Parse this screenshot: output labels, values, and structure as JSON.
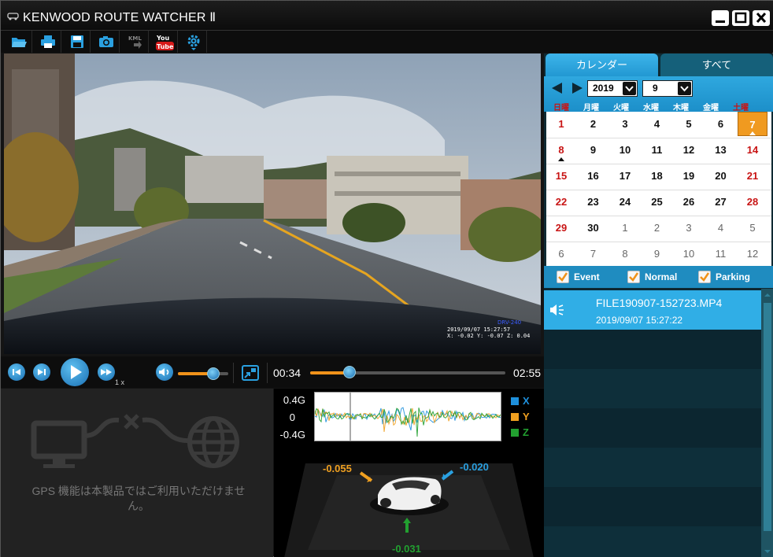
{
  "window": {
    "title": "KENWOOD ROUTE WATCHER Ⅱ"
  },
  "toolbar": {
    "items": [
      {
        "name": "open-folder-icon"
      },
      {
        "name": "print-icon"
      },
      {
        "name": "save-icon"
      },
      {
        "name": "camera-icon"
      },
      {
        "name": "kml-export-icon",
        "label": "KML"
      },
      {
        "name": "youtube-icon",
        "label_you": "You",
        "label_tube": "Tube"
      },
      {
        "name": "gear-icon"
      }
    ]
  },
  "video": {
    "osd_brand": "DRV-240",
    "osd_line1": "2019/09/07 15:27:57",
    "osd_line2": "X: -0.02 Y: -0.07 Z: 0.04"
  },
  "player": {
    "speed": "1 x",
    "current_time": "00:34",
    "total_time": "02:55",
    "progress": 0.2,
    "volume": 0.7
  },
  "gps": {
    "message": "GPS 機能は本製品ではご利用いただけません。"
  },
  "gsensor": {
    "top_label": "0.4G",
    "mid_label": "0",
    "bottom_label": "-0.4G",
    "legend": [
      {
        "axis": "X",
        "color": "#1e90dc"
      },
      {
        "axis": "Y",
        "color": "#f0a020"
      },
      {
        "axis": "Z",
        "color": "#22a030"
      }
    ],
    "y_value": "-0.055",
    "x_value": "-0.020",
    "z_value": "-0.031"
  },
  "calendar": {
    "tab_calendar": "カレンダー",
    "tab_all": "すべて",
    "year": "2019",
    "month": "9",
    "weekdays": [
      "日曜",
      "月曜",
      "火曜",
      "水曜",
      "木曜",
      "金曜",
      "土曜"
    ],
    "weeks": [
      [
        "1",
        "2",
        "3",
        "4",
        "5",
        "6",
        "7"
      ],
      [
        "8",
        "9",
        "10",
        "11",
        "12",
        "13",
        "14"
      ],
      [
        "15",
        "16",
        "17",
        "18",
        "19",
        "20",
        "21"
      ],
      [
        "22",
        "23",
        "24",
        "25",
        "26",
        "27",
        "28"
      ],
      [
        "29",
        "30",
        "1",
        "2",
        "3",
        "4",
        "5"
      ],
      [
        "6",
        "7",
        "8",
        "9",
        "10",
        "11",
        "12"
      ]
    ],
    "selected_day": "7",
    "colors": {
      "sunday": "#c81414",
      "saturday": "#c81414",
      "other_month": "#666",
      "selected": "#f09a20"
    }
  },
  "filters": {
    "event": "Event",
    "normal": "Normal",
    "parking": "Parking"
  },
  "files": [
    {
      "name": "FILE190907-152723.MP4",
      "date": "2019/09/07   15:27:22"
    }
  ]
}
